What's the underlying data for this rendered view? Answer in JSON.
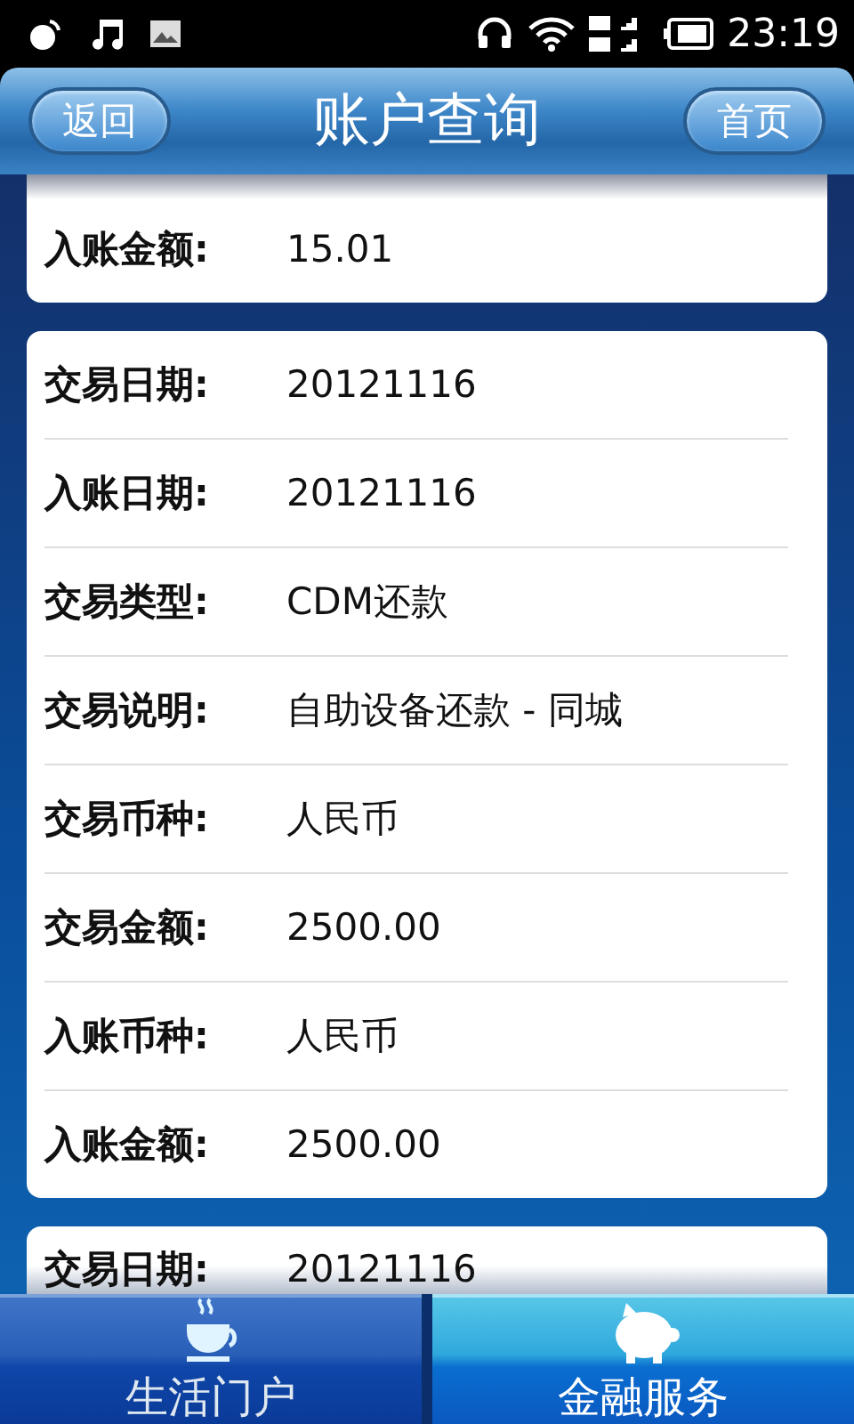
{
  "status_bar": {
    "time": "23:19"
  },
  "header": {
    "back": "返回",
    "title": "账户查询",
    "home": "首页"
  },
  "records": [
    {
      "fields": [
        {
          "label": "入账金额:",
          "value": "15.01"
        }
      ]
    },
    {
      "fields": [
        {
          "label": "交易日期:",
          "value": "20121116"
        },
        {
          "label": "入账日期:",
          "value": "20121116"
        },
        {
          "label": "交易类型:",
          "value": "CDM还款"
        },
        {
          "label": "交易说明:",
          "value": "自助设备还款 - 同城"
        },
        {
          "label": "交易币种:",
          "value": "人民币"
        },
        {
          "label": "交易金额:",
          "value": "2500.00"
        },
        {
          "label": "入账币种:",
          "value": "人民币"
        },
        {
          "label": "入账金额:",
          "value": "2500.00"
        }
      ]
    },
    {
      "fields": [
        {
          "label": "交易日期:",
          "value": "20121116"
        }
      ]
    }
  ],
  "tabs": [
    {
      "kind": "cup",
      "label": "生活门户",
      "selected": false
    },
    {
      "kind": "piggy",
      "label": "金融服务",
      "selected": true
    }
  ]
}
